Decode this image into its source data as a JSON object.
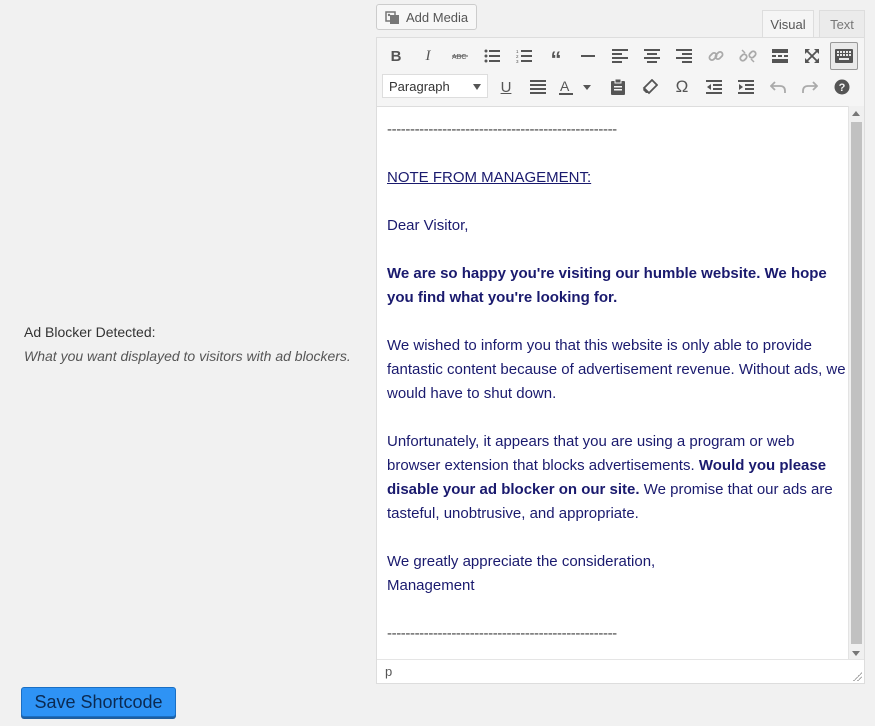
{
  "field": {
    "label": "Ad Blocker Detected:",
    "description": "What you want displayed to visitors with ad blockers."
  },
  "editor": {
    "add_media_label": "Add Media",
    "tabs": {
      "visual": "Visual",
      "text": "Text"
    },
    "format_select": "Paragraph",
    "status_path": "p",
    "content": {
      "rule_top": "--------------------------------------------------",
      "heading": "NOTE FROM MANAGEMENT:",
      "greeting": "Dear Visitor,",
      "para1": "We are so happy you're visiting our humble website.  We hope you find what you're looking for.",
      "para2": "We wished to inform you that this website is only able to provide fantastic content because of advertisement revenue.  Without ads, we would have to shut down.",
      "para3_start": "Unfortunately, it appears that you are using a program or web browser extension that blocks advertisements. ",
      "para3_bold": "Would you please disable your ad blocker on our site.",
      "para3_end": "  We promise that our ads are tasteful, unobtrusive, and appropriate.",
      "closing_line1": "We greatly appreciate the consideration,",
      "closing_line2": "Management",
      "rule_bottom": "--------------------------------------------------"
    }
  },
  "toolbar_icons": {
    "bold": "B",
    "italic": "I",
    "underline": "U",
    "omega": "Ω",
    "help": "?"
  },
  "save_button_label": "Save Shortcode"
}
